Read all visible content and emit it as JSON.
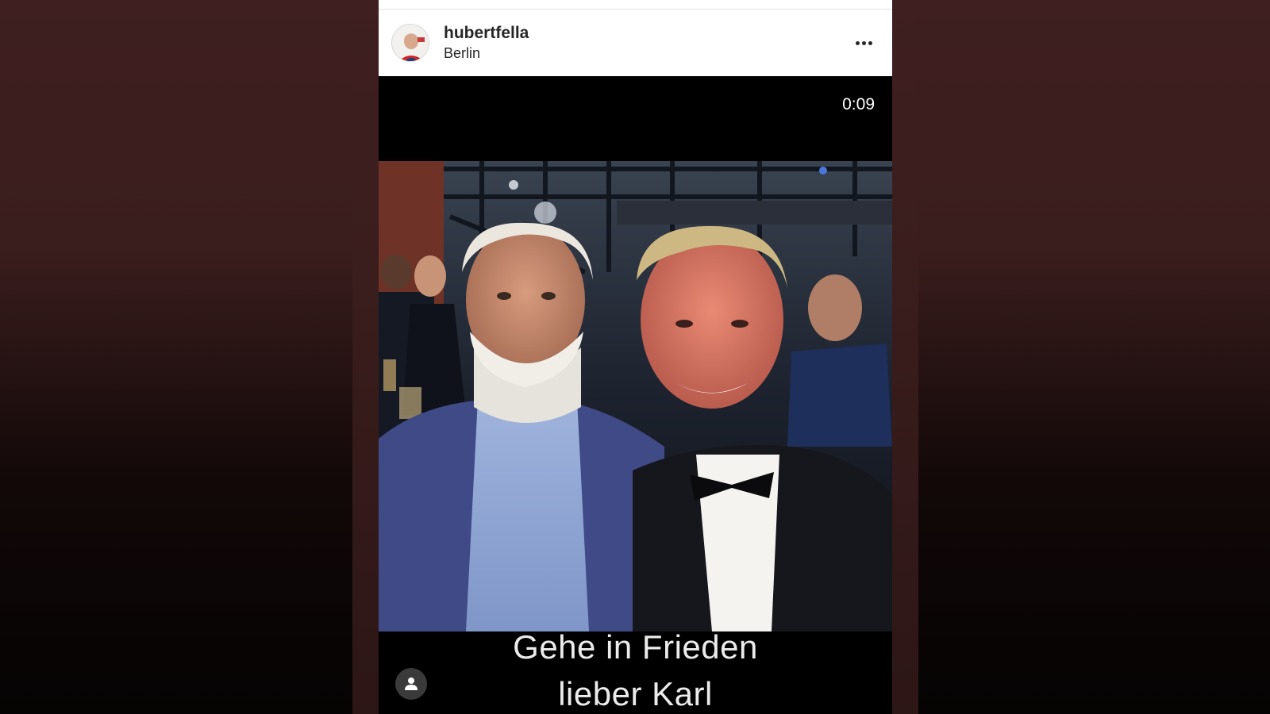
{
  "post": {
    "username": "hubertfella",
    "location": "Berlin",
    "timer": "0:09",
    "caption_line1": "Gehe in Frieden",
    "caption_line2": "lieber Karl"
  },
  "icons": {
    "more": "more-options-icon",
    "user_tag": "user-tag-icon",
    "avatar": "profile-avatar"
  },
  "colors": {
    "background": "#3f1f1f",
    "header_bg": "#ffffff",
    "text_primary": "#262626",
    "video_bg": "#000000"
  }
}
